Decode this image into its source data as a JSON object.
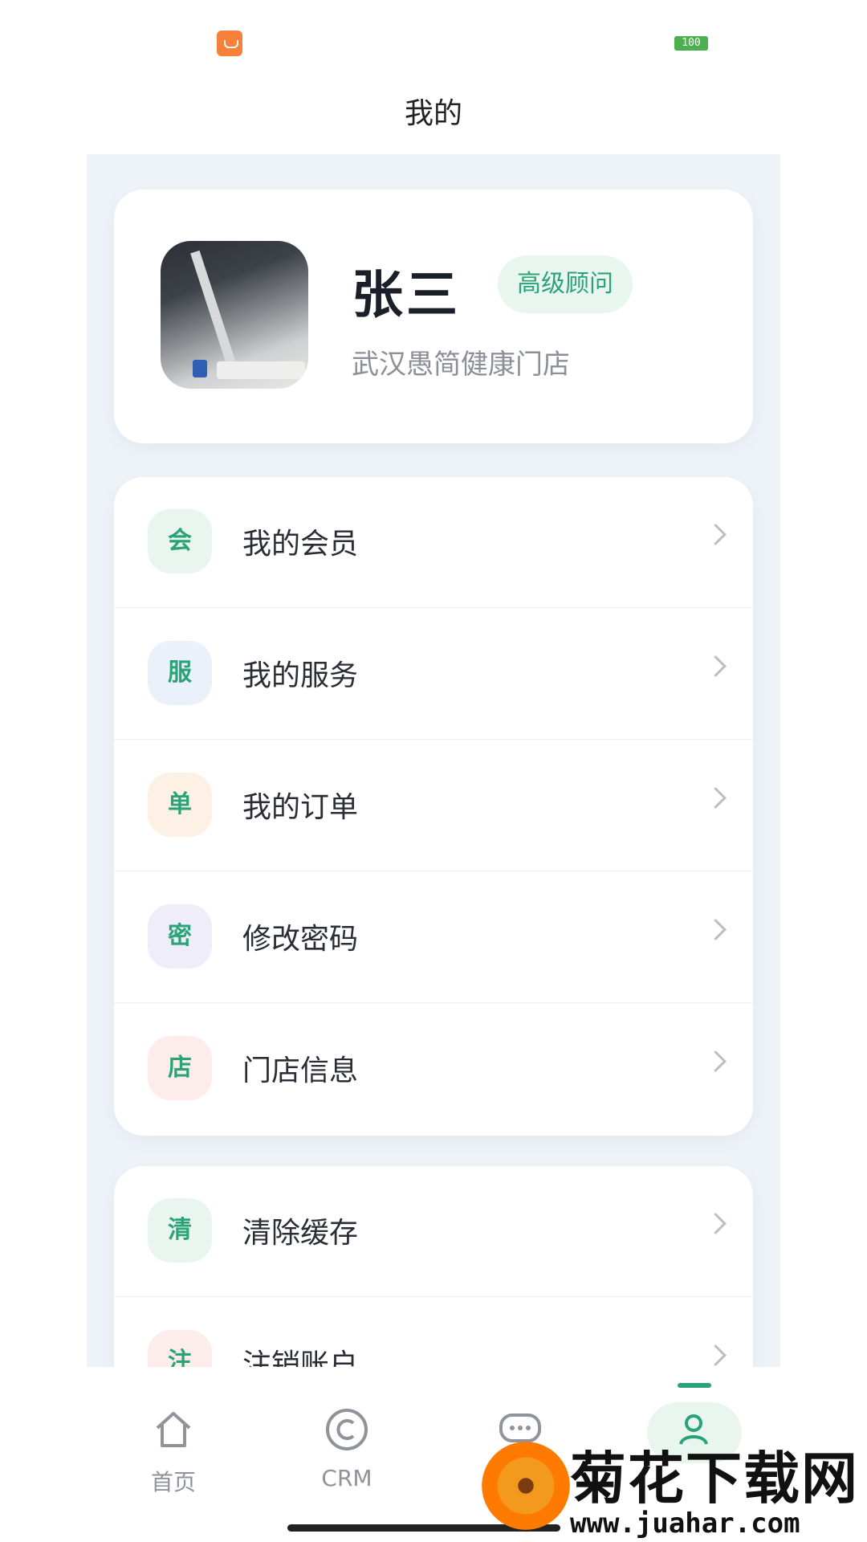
{
  "status_bar": {
    "battery": "100",
    "app_icon": "shopping-bag-icon"
  },
  "header": {
    "title": "我的"
  },
  "profile": {
    "name": "张三",
    "role": "高级顾问",
    "store": "武汉愚简健康门店",
    "avatar": "user-avatar-photo"
  },
  "menu_group_1": [
    {
      "icon_char": "会",
      "label": "我的会员",
      "icon_bg": "#e8f6ef"
    },
    {
      "icon_char": "服",
      "label": "我的服务",
      "icon_bg": "#eaf1fb"
    },
    {
      "icon_char": "单",
      "label": "我的订单",
      "icon_bg": "#fdf1e6"
    },
    {
      "icon_char": "密",
      "label": "修改密码",
      "icon_bg": "#f0edfb"
    },
    {
      "icon_char": "店",
      "label": "门店信息",
      "icon_bg": "#fdecec"
    }
  ],
  "menu_group_2": [
    {
      "icon_char": "清",
      "label": "清除缓存",
      "icon_bg": "#e8f6ef"
    },
    {
      "icon_char": "注",
      "label": "注销账户",
      "icon_bg": "#fdecec"
    }
  ],
  "bottom_nav": [
    {
      "label": "首页",
      "icon": "home-icon"
    },
    {
      "label": "CRM",
      "icon": "copyright-circle-icon"
    },
    {
      "label": "",
      "icon": "chat-bubble-icon"
    },
    {
      "label": "",
      "icon": "user-icon",
      "active": true
    }
  ],
  "watermark": {
    "title": "菊花下载网",
    "url": "www.juahar.com"
  },
  "colors": {
    "accent": "#2aa376",
    "panel_bg": "#eef3f8"
  }
}
